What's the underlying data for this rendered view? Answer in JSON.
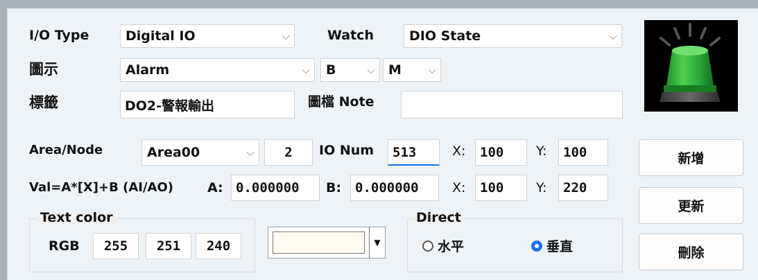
{
  "row1": {
    "io_type_label": "I/O Type",
    "io_type_value": "Digital IO",
    "watch_label": "Watch",
    "watch_value": "DIO State"
  },
  "row2": {
    "icon_label": "圖示",
    "icon_value": "Alarm",
    "b_value": "B",
    "m_value": "M"
  },
  "row3": {
    "tag_label": "標籤",
    "tag_value": "DO2-警報輸出",
    "note_label": "圖檔 Note",
    "note_value": ""
  },
  "row4": {
    "area_label": "Area/Node",
    "area_value": "Area00",
    "node_value": "2",
    "ionum_label": "IO Num",
    "ionum_value": "513",
    "x_label": "X:",
    "x_value": "100",
    "y_label": "Y:",
    "y_value": "100"
  },
  "row5": {
    "formula_label": "Val=A*[X]+B (AI/AO)",
    "a_label": "A:",
    "a_value": "0.000000",
    "b_label": "B:",
    "b_value": "0.000000",
    "x_label": "X:",
    "x_value": "100",
    "y_label": "Y:",
    "y_value": "220"
  },
  "text_color": {
    "title": "Text color",
    "rgb_label": "RGB",
    "r": "255",
    "g": "251",
    "b": "240",
    "swatch": "#fffbf0"
  },
  "direct": {
    "title": "Direct",
    "horizontal": "水平",
    "vertical": "垂直",
    "selected": "vertical"
  },
  "buttons": {
    "add": "新增",
    "update": "更新",
    "delete": "刪除"
  },
  "preview": {
    "icon": "green-alarm-light-icon"
  }
}
